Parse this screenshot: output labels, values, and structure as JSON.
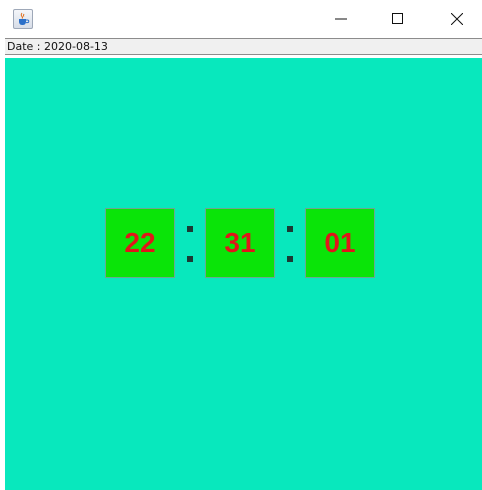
{
  "window": {
    "app_icon": "java-coffee-cup-icon",
    "controls": [
      "minimize-icon",
      "maximize-icon",
      "close-icon"
    ]
  },
  "date_label": "Date : 2020-08-13",
  "clock": {
    "hours": "22",
    "minutes": "31",
    "seconds": "01",
    "separator": ":"
  },
  "colors": {
    "background": "#08e8bd",
    "tile": "#0ae408",
    "digits": "#e0161a",
    "separator": "#1b3b35"
  }
}
